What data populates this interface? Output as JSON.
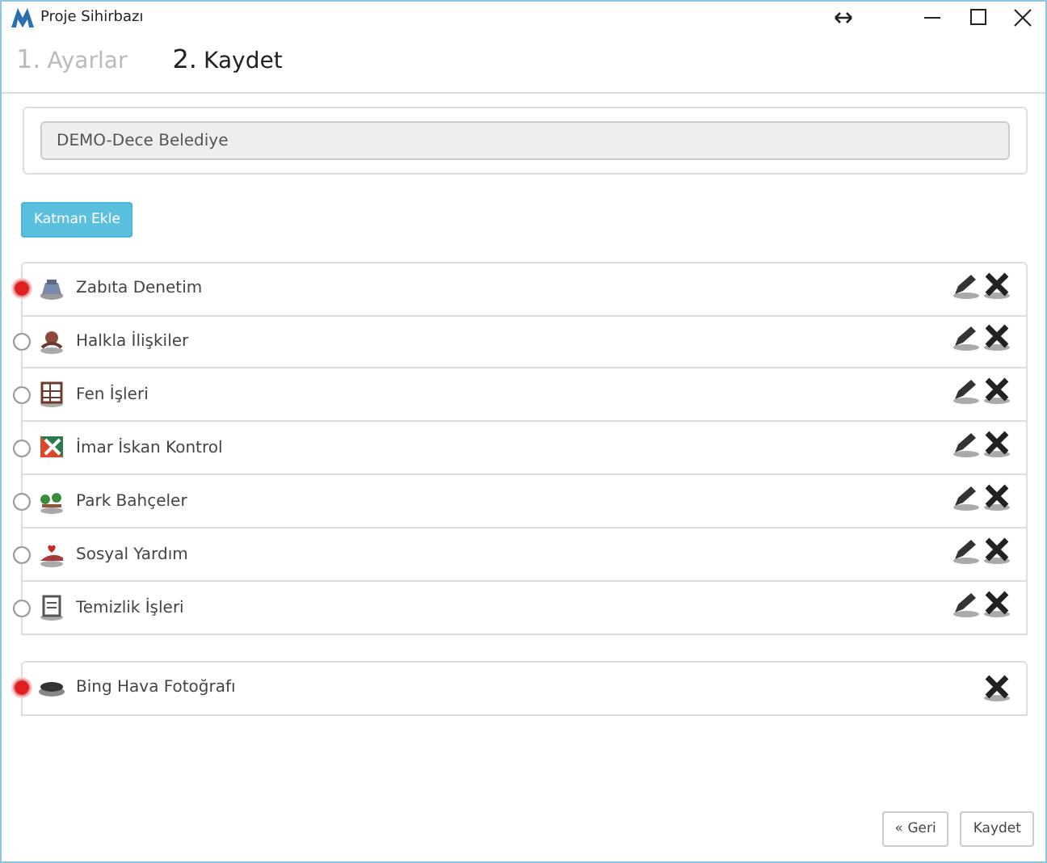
{
  "window": {
    "title": "Proje Sihirbazı"
  },
  "steps": [
    {
      "number": "1.",
      "label": "Ayarlar",
      "selected": false
    },
    {
      "number": "2.",
      "label": "Kaydet",
      "selected": true
    }
  ],
  "project_field": {
    "value": "DEMO-Dece Belediye"
  },
  "add_layer_button": "Katman Ekle",
  "layers": [
    {
      "name": "Zabıta Denetim",
      "selected": true,
      "editable": true
    },
    {
      "name": "Halkla İlişkiler",
      "selected": false,
      "editable": true
    },
    {
      "name": "Fen İşleri",
      "selected": false,
      "editable": true
    },
    {
      "name": "İmar İskan Kontrol",
      "selected": false,
      "editable": true
    },
    {
      "name": "Park Bahçeler",
      "selected": false,
      "editable": true
    },
    {
      "name": "Sosyal Yardım",
      "selected": false,
      "editable": true
    },
    {
      "name": "Temizlik İşleri",
      "selected": false,
      "editable": true
    }
  ],
  "base_layers": [
    {
      "name": "Bing Hava Fotoğrafı",
      "selected": true,
      "editable": false
    }
  ],
  "buttons": [
    {
      "label": "« Geri"
    },
    {
      "label": "Kaydet"
    }
  ]
}
